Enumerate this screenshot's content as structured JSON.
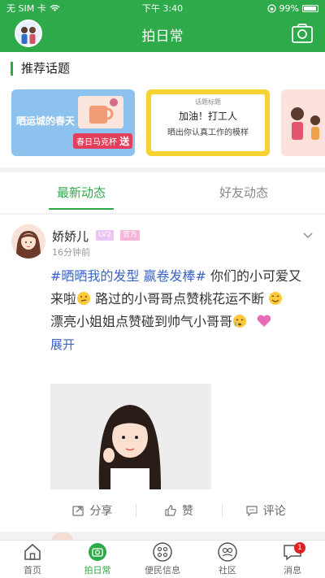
{
  "status_bar": {
    "carrier": "无 SIM 卡",
    "time": "下午 3:40",
    "battery": "99%"
  },
  "nav": {
    "title": "拍日常",
    "avatar_icon": "avatar-couple-icon",
    "camera_icon": "camera-icon"
  },
  "topics": {
    "title": "推荐话题",
    "cards": [
      {
        "name": "晒运城的春天",
        "sub": "春日马克杯",
        "tag": "送"
      },
      {
        "name": "加油！打工人",
        "sub": "晒出你认真工作的模样",
        "hint": "话题标题"
      },
      {
        "name": ""
      }
    ]
  },
  "feed_tabs": [
    {
      "label": "最新动态",
      "active": true
    },
    {
      "label": "好友动态",
      "active": false
    }
  ],
  "post": {
    "author": "娇娇儿",
    "level_badge": "LV2",
    "role_badge": "官方",
    "time": "16分钟前",
    "hashtag": "#晒晒我的发型 赢卷发棒#",
    "line1": "你们的小可爱又来啦",
    "line2": "路过的小哥哥点赞桃花运不断",
    "line3": "漂亮小姐姐点赞碰到帅气小哥哥",
    "expand": "展开",
    "actions": {
      "share": "分享",
      "like": "赞",
      "comment": "评论"
    }
  },
  "tab_bar": [
    {
      "label": "首页",
      "icon": "home-icon"
    },
    {
      "label": "拍日常",
      "icon": "camera-circle-icon",
      "active": true
    },
    {
      "label": "便民信息",
      "icon": "grid-icon"
    },
    {
      "label": "社区",
      "icon": "community-icon"
    },
    {
      "label": "消息",
      "icon": "message-icon",
      "badge": "1"
    }
  ],
  "colors": {
    "brand": "#2eaa4a",
    "link": "#3a64c8"
  }
}
